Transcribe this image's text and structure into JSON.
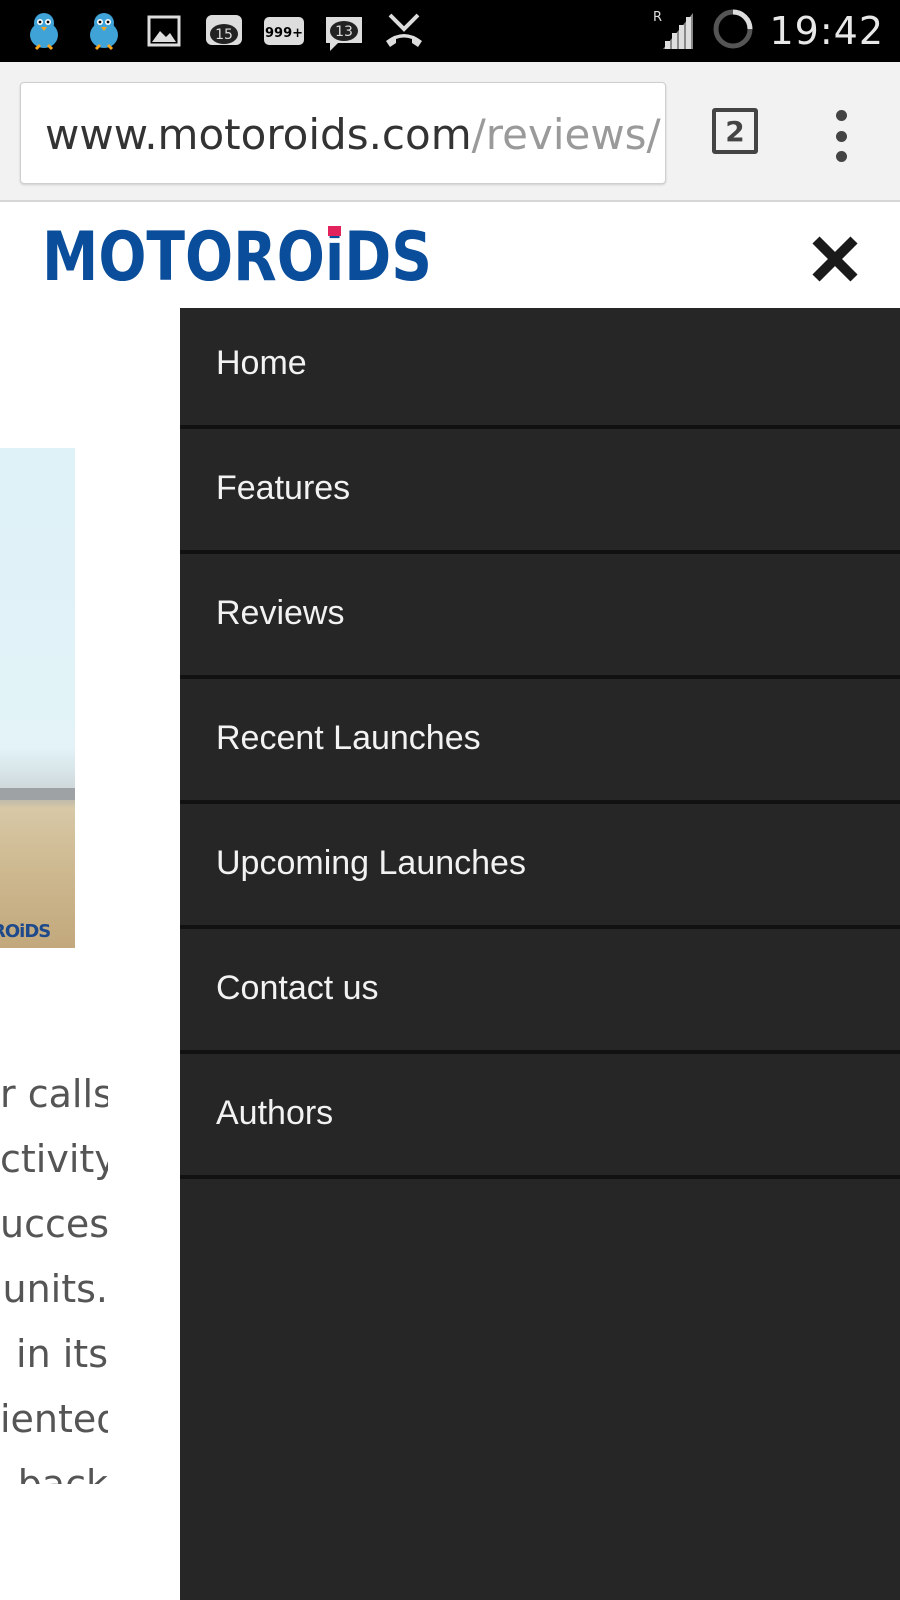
{
  "status_bar": {
    "time": "19:42",
    "notification_icons": [
      "twitter-bird-icon",
      "twitter-bird-icon",
      "image-icon",
      "message-count-icon",
      "message-count-icon",
      "message-count-icon",
      "missed-call-icon"
    ],
    "badges": [
      "15",
      "999+",
      "13"
    ],
    "signal_label": "R"
  },
  "browser": {
    "url_host": "www.motoroids.com",
    "url_path": "/reviews/",
    "tab_count": "2"
  },
  "site": {
    "logo_text": "MOTOROiDS",
    "brand_color": "#0a4d9a",
    "accent_color": "#e2225d"
  },
  "background_page": {
    "image_watermark": "ROiDS",
    "text_fragments": [
      "r calls",
      "ctivity",
      "uccess",
      "units.",
      "in its",
      "iented",
      "back"
    ]
  },
  "drawer": {
    "items": [
      {
        "label": "Home"
      },
      {
        "label": "Features"
      },
      {
        "label": "Reviews"
      },
      {
        "label": "Recent Launches"
      },
      {
        "label": "Upcoming Launches"
      },
      {
        "label": "Contact us"
      },
      {
        "label": "Authors"
      }
    ]
  }
}
